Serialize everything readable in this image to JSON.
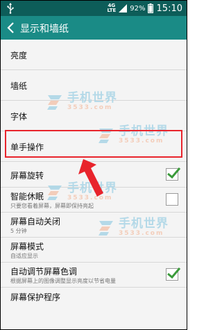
{
  "status_bar": {
    "network_top": "4G",
    "network_bottom": "LTE",
    "battery": "92%",
    "time": "15:10"
  },
  "header": {
    "title": "显示和墙纸"
  },
  "settings": {
    "brightness": "亮度",
    "wallpaper": "墙纸",
    "font": "字体",
    "one_handed": "单手操作",
    "rotate_screen": {
      "label": "屏幕旋转",
      "checked": true
    },
    "smart_stay": {
      "label": "智能休眠",
      "sub": "只要您看着屏幕，屏幕即保持亮起",
      "checked": false
    },
    "screen_timeout": {
      "label": "屏幕自动关闭",
      "sub": "5 分钟"
    },
    "screen_mode": {
      "label": "屏幕模式",
      "sub": "自适应显示"
    },
    "auto_adjust_tone": {
      "label": "自动调节屏幕色调",
      "sub": "根据屏幕上的图像调整显示亮度以节省电量",
      "checked": true
    },
    "screen_saver": "屏幕保护程序"
  },
  "watermark": {
    "text": "手机世界",
    "number": "3533.com"
  },
  "colors": {
    "status_bar": "#0d5d59",
    "app_bar": "#1a8b86",
    "check_green": "#3a9a3a",
    "highlight_red": "#e8242c"
  }
}
